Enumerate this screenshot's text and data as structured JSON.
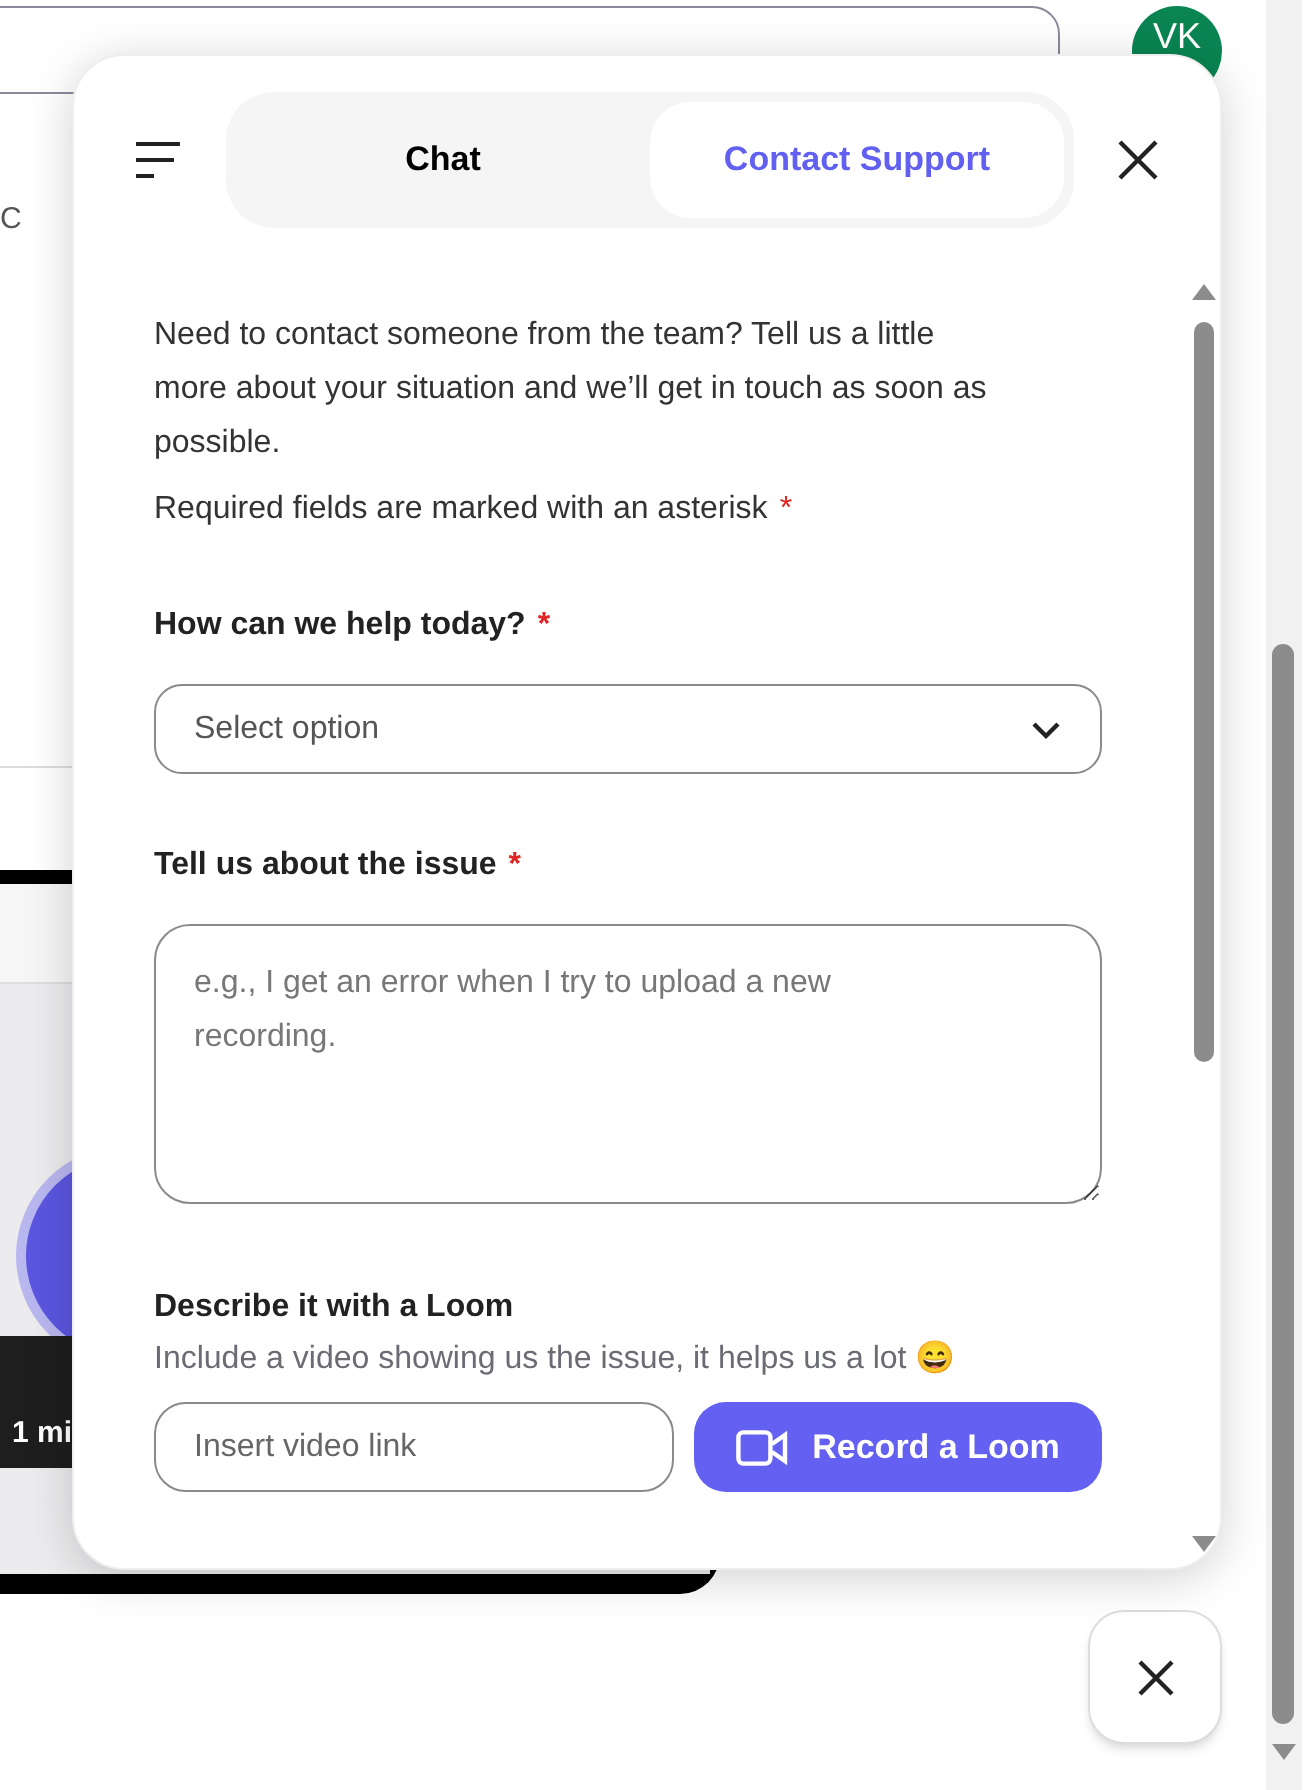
{
  "background": {
    "avatar": "VK",
    "side_text": "C",
    "video_duration": "1 mi"
  },
  "panel": {
    "tabs": [
      {
        "label": "Chat",
        "selected": false
      },
      {
        "label": "Contact Support",
        "selected": true
      }
    ],
    "intro": "Need to contact someone from the team? Tell us a little more about your situation and we’ll get in touch as soon as possible.",
    "required_note": {
      "text": "Required fields are marked with an asterisk",
      "mark": "*"
    },
    "fields": [
      {
        "kind": "select",
        "label": "How can we help today?",
        "required_mark": "*",
        "placeholder": "Select option"
      },
      {
        "kind": "textarea",
        "label": "Tell us about the issue",
        "required_mark": "*",
        "placeholder": "e.g., I get an error when I try to upload a new recording."
      }
    ],
    "loom": {
      "title": "Describe it with a Loom",
      "description": "Include a video showing us the issue, it helps us a lot 😄",
      "link_field": {
        "placeholder": "Insert video link"
      },
      "record_button": "Record a Loom"
    }
  }
}
